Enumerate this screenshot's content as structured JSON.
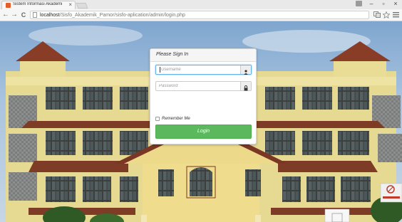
{
  "browser": {
    "tab_title": "Sistem Informasi Akademi",
    "tab_close": "×",
    "window_controls": {
      "minimize": "–",
      "maximize": "▫",
      "close": "×"
    },
    "nav": {
      "back": "←",
      "forward": "→",
      "reload": "C"
    },
    "url_host": "localhost",
    "url_path": "/Sisfo_Akademik_Pamor/sisfo-aplication/admin/login.php",
    "toolbar_icons": [
      "translate-icon",
      "star-icon",
      "menu-icon"
    ]
  },
  "login": {
    "heading": "Please Sign In",
    "username_placeholder": "Username",
    "password_placeholder": "Password",
    "remember_label": "Remember Me",
    "remember_checked": false,
    "button_label": "Login"
  },
  "colors": {
    "login_button": "#5cb85c",
    "focus_border": "#66afe9",
    "building_wall": "#e6d992",
    "roof": "#8a3d26",
    "sky": "#8fb2d6",
    "favicon": "#e65c29"
  }
}
